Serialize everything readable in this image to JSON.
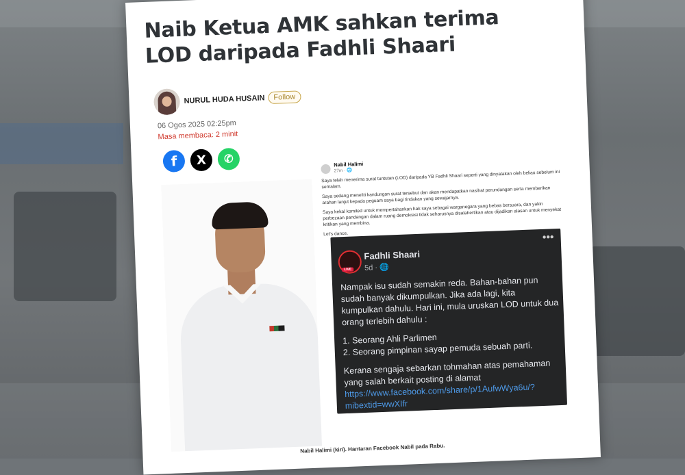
{
  "article": {
    "title": "Naib Ketua AMK sahkan terima LOD daripada Fadhli Shaari",
    "author": "NURUL HUDA HUSAIN",
    "follow_label": "Follow",
    "date": "06 Ogos 2025 02:25pm",
    "read_time": "Masa membaca: 2 minit",
    "share": {
      "facebook": "f",
      "x": "X",
      "whatsapp": "✆"
    },
    "caption": "Nabil Halimi (kiri). Hantaran Facebook Nabil pada Rabu."
  },
  "fb_post": {
    "name": "Nabil Halimi",
    "time": "27m · 🌐",
    "paragraphs": [
      "Saya telah menerima surat tuntutan (LOD) daripada YB Fadhli Shaari seperti yang dinyatakan oleh beliau sebelum ini semalam.",
      "Saya sedang meneliti kandungan surat tersebut dan akan mendapatkan nasihat perundangan serta memberikan arahan lanjut kepada peguam saya bagi tindakan yang sewajarnya.",
      "Saya kekal komited untuk mempertahankan hak saya sebagai warganegara yang bebas bersuara, dan yakin perbezaan pandangan dalam ruang demokrasi tidak seharusnya disalahertikan atau dijadikan alasan untuk menyekat kritikan yang membina.",
      "Let's dance."
    ],
    "shared": {
      "name": "Fadhli Shaari",
      "time": "5d · 🌐",
      "live_label": "LIVE",
      "p1": "Nampak isu sudah semakin reda. Bahan-bahan pun sudah banyak dikumpulkan. Jika ada lagi, kita kumpulkan dahulu. Hari ini, mula uruskan LOD untuk dua orang terlebih dahulu :",
      "item1": "1. Seorang Ahli Parlimen",
      "item2": "2. Seorang pimpinan sayap pemuda sebuah parti.",
      "p3": "Kerana sengaja sebarkan tohmahan atas pemahaman yang salah berkait posting di alamat",
      "link": "https://www.facebook.com/share/p/1AufwWya6u/?mibextid=wwXIfr"
    }
  }
}
